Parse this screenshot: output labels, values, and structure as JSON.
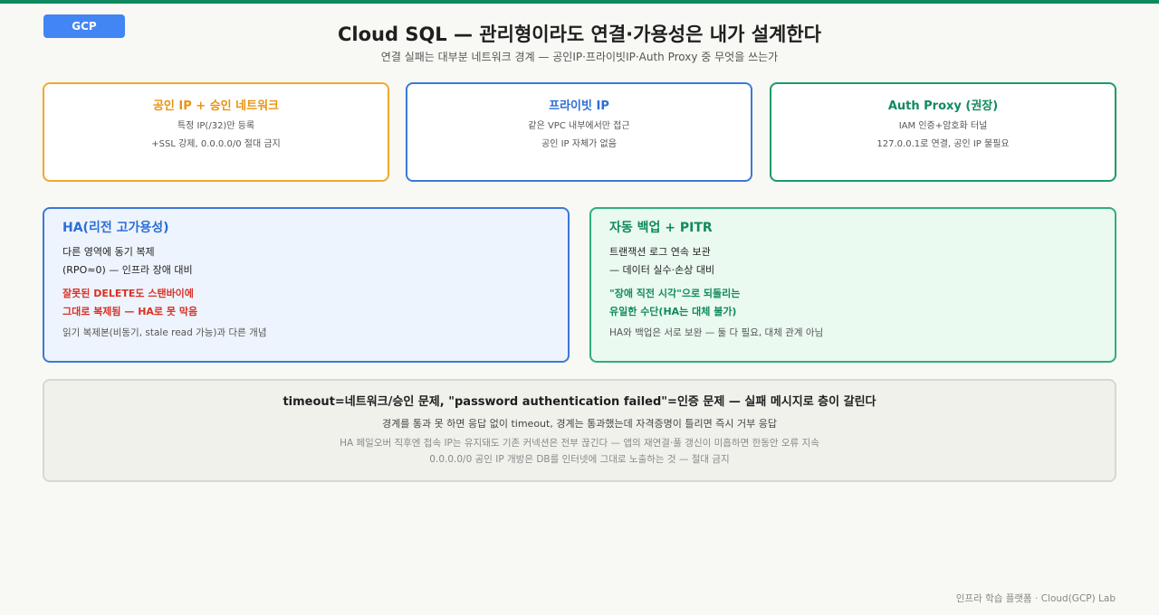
{
  "badge": "GCP",
  "title": "Cloud SQL — 관리형이라도 연결·가용성은 내가 설계한다",
  "subtitle": "연결 실패는 대부분 네트워크 경계 — 공인IP·프라이빗IP·Auth Proxy 중 무엇을 쓰는가",
  "connection_cards": [
    {
      "title": "공인 IP + 승인 네트워크",
      "line1": "특정 IP(/32)만 등록",
      "line2": "+SSL 강제, 0.0.0.0/0 절대 금지",
      "color": "#f0a92e"
    },
    {
      "title": "프라이빗 IP",
      "line1": "같은 VPC 내부에서만 접근",
      "line2": "공인 IP 자체가 없음",
      "color": "#3c78d8"
    },
    {
      "title": "Auth Proxy (권장)",
      "line1": "IAM 인증+암호화 터널",
      "line2": "127.0.0.1로 연결, 공인 IP 불필요",
      "color": "#1b9a6b"
    }
  ],
  "ha_card": {
    "title": "HA(리전 고가용성)",
    "line1": "다른 영역에 동기 복제",
    "line2": "(RPO≈0) — 인프라 장애 대비",
    "warn1": "잘못된 DELETE도 스탠바이에",
    "warn2": "그대로 복제됨 — HA로 못 막음",
    "note": "읽기 복제본(비동기, stale read 가능)과 다른 개념"
  },
  "backup_card": {
    "title": "자동 백업 + PITR",
    "line1": "트랜잭션 로그 연속 보관",
    "line2": "— 데이터 실수·손상 대비",
    "hl1": "\"장애 직전 시각\"으로 되돌리는",
    "hl2": "유일한 수단(HA는 대체 불가)",
    "note": "HA와 백업은 서로 보완 — 둘 다 필요, 대체 관계 아님"
  },
  "bottom": {
    "title": "timeout=네트워크/승인 문제, \"password authentication failed\"=인증 문제 — 실패 메시지로 층이 갈린다",
    "sub": "경계를 통과 못 하면 응답 없이 timeout, 경계는 통과했는데 자격증명이 틀리면 즉시 거부 응답",
    "note1": "HA 페일오버 직후엔 접속 IP는 유지돼도 기존 커넥션은 전부 끊긴다 — 앱의 재연결·풀 갱신이 미흡하면 한동안 오류 지속",
    "note2": "0.0.0.0/0 공인 IP 개방은 DB를 인터넷에 그대로 노출하는 것 — 절대 금지"
  },
  "footer": "인프라 학습 플랫폼 · Cloud(GCP) Lab"
}
